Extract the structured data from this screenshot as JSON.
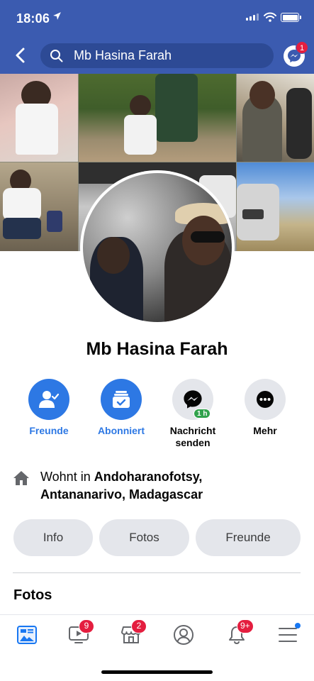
{
  "status_bar": {
    "time": "18:06"
  },
  "nav": {
    "search_text": "Mb Hasina Farah",
    "messenger_badge": "1"
  },
  "profile": {
    "name": "Mb Hasina Farah"
  },
  "actions": [
    {
      "label": "Freunde",
      "icon": "friends-check-icon",
      "style": "blue"
    },
    {
      "label": "Abonniert",
      "icon": "subscribed-inbox-icon",
      "style": "blue"
    },
    {
      "label": "Nachricht senden",
      "label_line1": "Nachricht",
      "label_line2": "senden",
      "icon": "messenger-icon",
      "style": "grey",
      "status": "1 h"
    },
    {
      "label": "Mehr",
      "icon": "more-icon",
      "style": "grey"
    }
  ],
  "lives_in": {
    "prefix": "Wohnt in ",
    "place_line1": "Andoharanofotsy,",
    "place_line2": "Antananarivo, Madagascar"
  },
  "pills": [
    {
      "label": "Info"
    },
    {
      "label": "Fotos"
    },
    {
      "label": "Freunde"
    }
  ],
  "section": {
    "title": "Fotos"
  },
  "tabbar": {
    "items": [
      {
        "name": "news-feed",
        "icon": "news-feed-icon",
        "badge": ""
      },
      {
        "name": "watch",
        "icon": "video-icon",
        "badge": "9"
      },
      {
        "name": "marketplace",
        "icon": "marketplace-icon",
        "badge": "2"
      },
      {
        "name": "profile",
        "icon": "profile-icon",
        "badge": ""
      },
      {
        "name": "notifications",
        "icon": "bell-icon",
        "badge": "9+"
      },
      {
        "name": "menu",
        "icon": "menu-icon",
        "badge": ""
      }
    ]
  },
  "colors": {
    "header": "#3b5bb0",
    "accent_blue": "#2d78e4",
    "badge_red": "#e41e3f",
    "online_green": "#31a24c",
    "pill_grey": "#e4e6eb"
  }
}
